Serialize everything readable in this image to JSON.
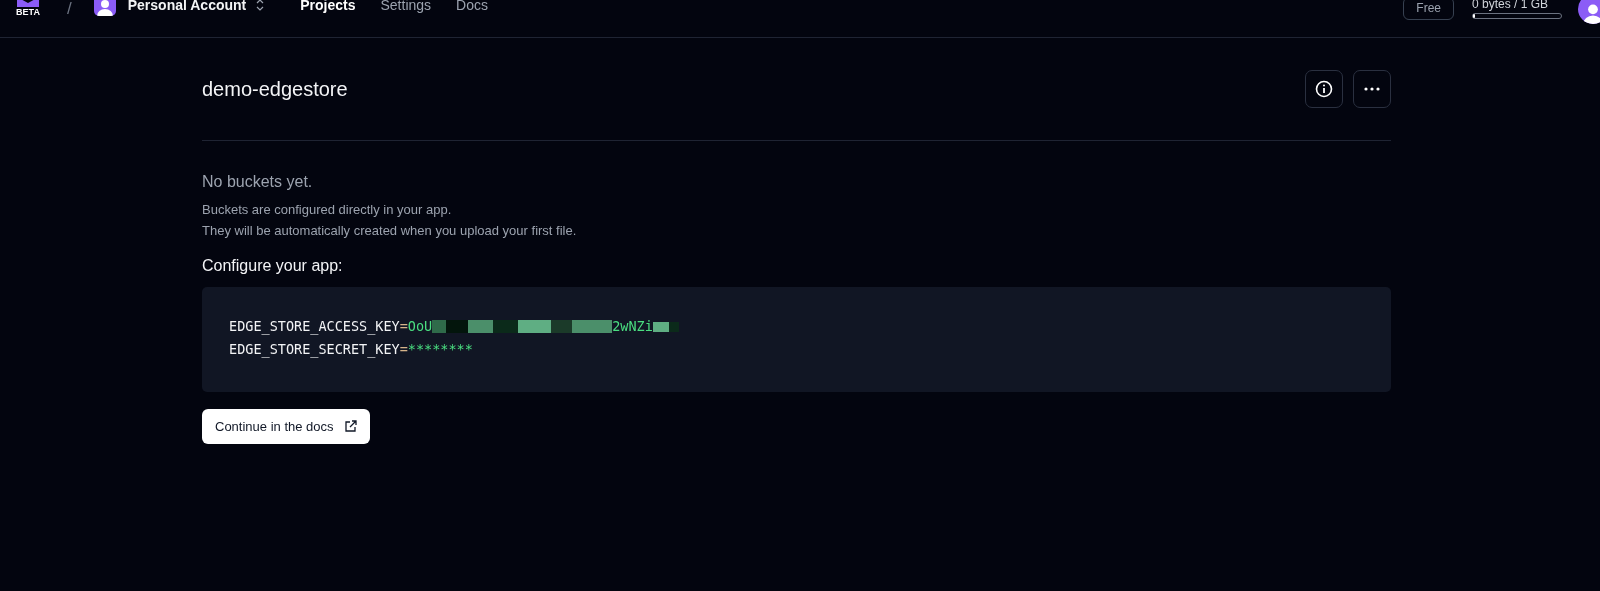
{
  "header": {
    "logo_badge": "BETA",
    "separator": "/",
    "account": "Personal Account",
    "nav": [
      {
        "label": "Projects",
        "selected": true
      },
      {
        "label": "Settings",
        "selected": false
      },
      {
        "label": "Docs",
        "selected": false
      }
    ],
    "plan": "Free",
    "storage": {
      "reading": "0 bytes / 1 GB",
      "level": 0.02
    }
  },
  "project": {
    "title": "demo-edgestore"
  },
  "empty_state": {
    "title": "No buckets yet.",
    "lines": [
      "Buckets are configured directly in your app.",
      "They will be automatically created when you upload your first file."
    ]
  },
  "configure": {
    "heading": "Configure your app:",
    "env": [
      {
        "name": "EDGE_STORE_ACCESS_KEY",
        "sign": "=",
        "value_start": "OoU",
        "redacted": true,
        "value_end": "2wNZi"
      },
      {
        "name": "EDGE_STORE_SECRET_KEY",
        "sign": "=",
        "value_start": "********",
        "redacted": false
      }
    ]
  },
  "docs_button": "Continue in the docs"
}
